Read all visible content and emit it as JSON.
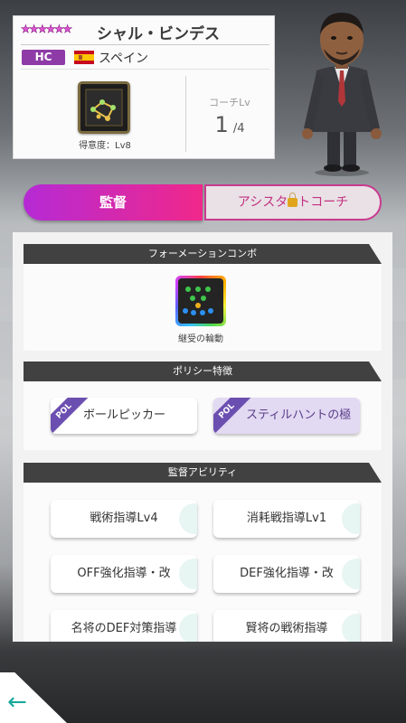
{
  "coach": {
    "stars": "★★★★★★",
    "name": "シャル・ビンデス",
    "badge": "HC",
    "country": "スペイン",
    "expertise_label": "得意度：Lv8",
    "coach_lv_label": "コーチLv",
    "coach_lv_value": "1",
    "coach_lv_max": "/4"
  },
  "tabs": {
    "manager": "監督",
    "assistant_pre": "アシスタ",
    "assistant_post": "トコーチ"
  },
  "sections": {
    "formation_combo": {
      "title": "フォーメーションコンボ",
      "item_label": "継受の輪動"
    },
    "policy": {
      "title": "ポリシー特徴",
      "tag": "POL",
      "items": [
        "ボールピッカー",
        "スティルハントの極意"
      ]
    },
    "abilities": {
      "title": "監督アビリティ",
      "items": [
        "戦術指導Lv4",
        "消耗戦指導Lv1",
        "OFF強化指導・改",
        "DEF強化指導・改",
        "名将のDEF対策指導",
        "賢将の戦術指導"
      ]
    }
  },
  "colors": {
    "tab_active_start": "#b52ad5",
    "tab_active_end": "#f0288a",
    "hc_badge": "#8e3ba8",
    "back_arrow": "#17a99a"
  },
  "icons": {
    "back": "left-arrow-icon",
    "lock": "lock-icon"
  }
}
